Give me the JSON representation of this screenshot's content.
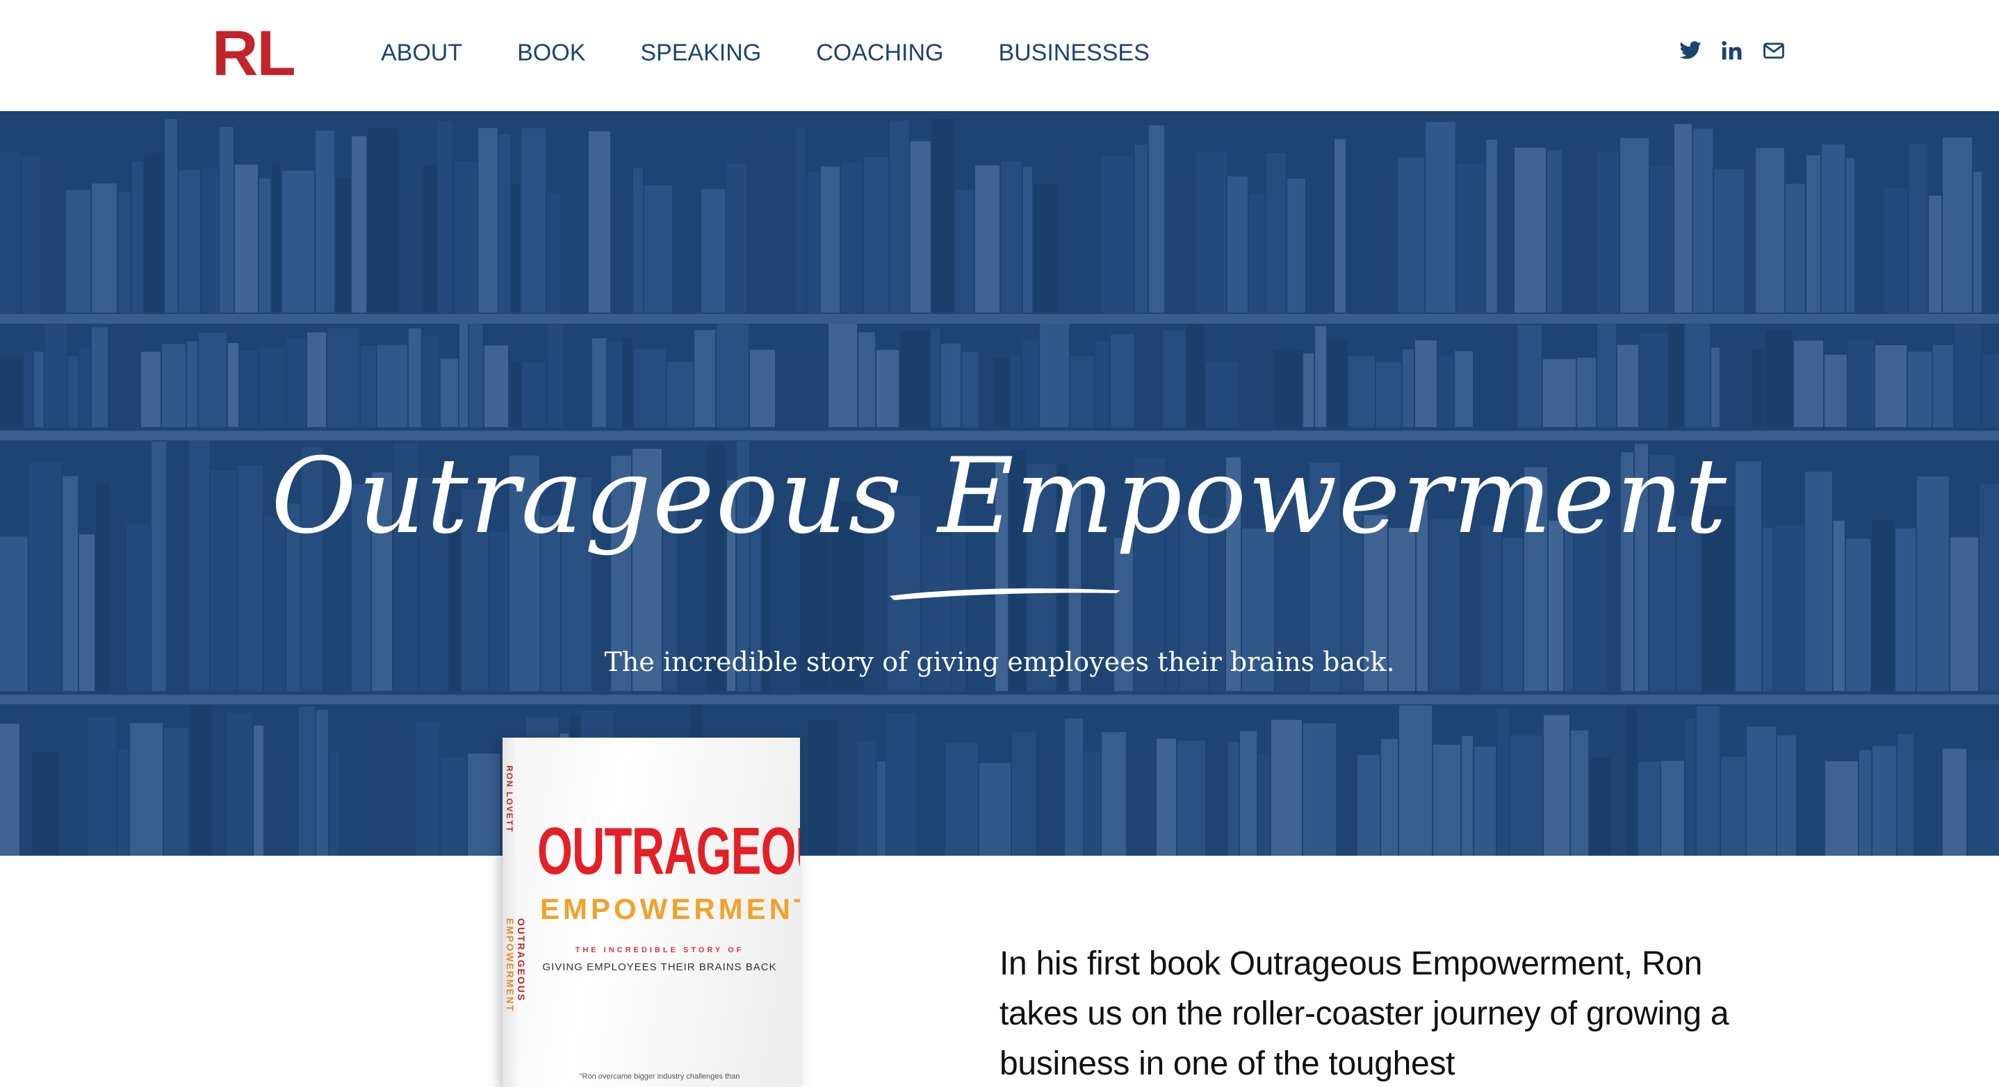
{
  "header": {
    "logo": "RL",
    "nav": [
      "ABOUT",
      "BOOK",
      "SPEAKING",
      "COACHING",
      "BUSINESSES"
    ],
    "social_icons": [
      "twitter-icon",
      "linkedin-icon",
      "mail-icon"
    ]
  },
  "hero": {
    "title": "Outrageous Empowerment",
    "subtitle": "The incredible story of giving employees their brains back."
  },
  "book_cover": {
    "spine_author": "RON LOVETT",
    "spine_title_a": "OUTRAGEOUS",
    "spine_title_b": "EMPOWERMENT",
    "title_line1": "OUTRAGEOUS",
    "title_line2": "EMPOWERMENT",
    "tagline1": "THE INCREDIBLE STORY OF",
    "tagline2": "GIVING EMPLOYEES THEIR BRAINS BACK",
    "quote": "\"Ron overcame bigger industry challenges than"
  },
  "intro": {
    "text": "In his first book Outrageous Empowerment, Ron takes us on the roller-coaster journey of growing a business in one of the toughest"
  },
  "colors": {
    "brand_red": "#c3232b",
    "nav_blue": "#1c4470",
    "hero_blue": "#1f4672",
    "accent_orange": "#f0a22b"
  }
}
